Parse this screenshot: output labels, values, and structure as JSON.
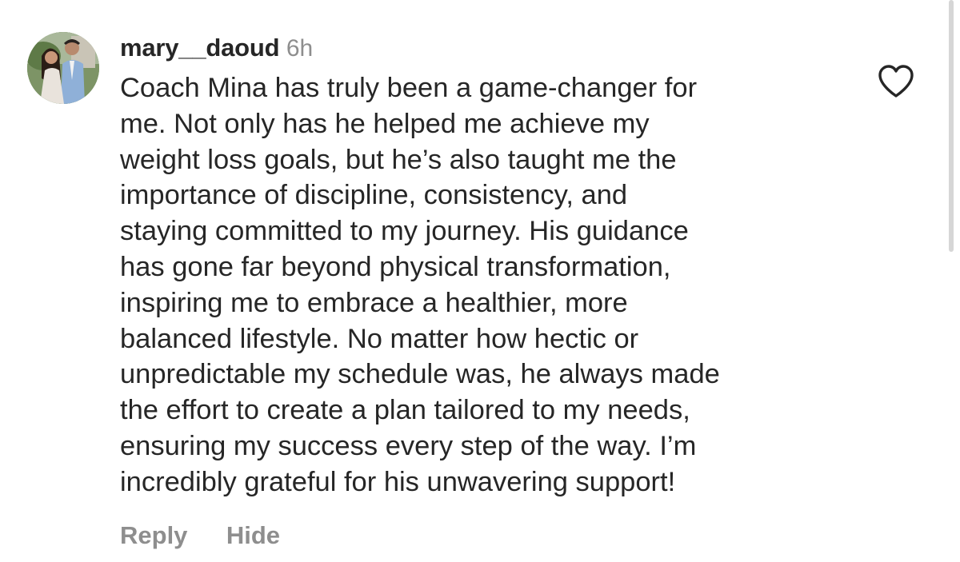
{
  "comment": {
    "username": "mary__daoud",
    "timestamp": "6h",
    "lines": [
      "Coach Mina has truly been a game-changer for",
      "me. Not only has he helped me achieve my",
      "weight loss goals, but he’s also taught me the",
      "importance of discipline, consistency, and",
      "staying committed to my journey. His guidance",
      "has gone far beyond physical transformation,",
      "inspiring me to embrace a healthier, more",
      "balanced lifestyle. No matter how hectic or",
      "unpredictable my schedule was, he always made",
      "the effort to create a plan tailored to my needs,",
      "ensuring my success every step of the way. I’m",
      "incredibly grateful for his unwavering support!"
    ],
    "reply_label": "Reply",
    "hide_label": "Hide",
    "like_icon": "heart-outline-icon"
  },
  "colors": {
    "text": "#262626",
    "secondary": "#8e8e8e",
    "background": "#ffffff"
  }
}
